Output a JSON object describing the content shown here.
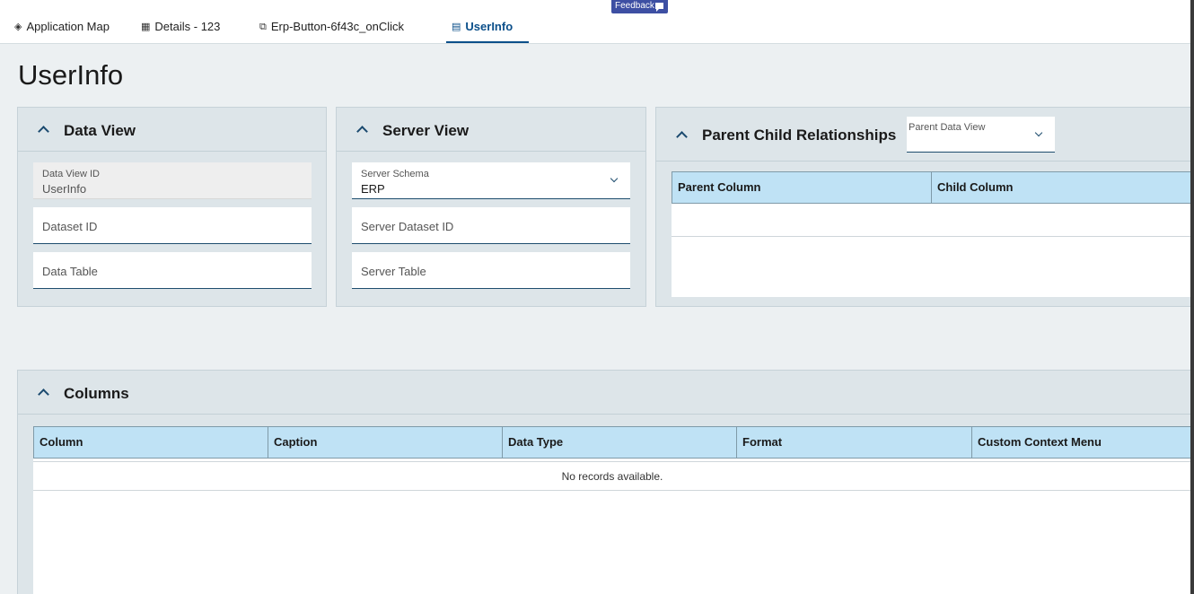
{
  "tabs": [
    {
      "label": "Application Map",
      "icon": "layers-icon"
    },
    {
      "label": "Details - 123",
      "icon": "grid-icon"
    },
    {
      "label": "Erp-Button-6f43c_onClick",
      "icon": "code-icon"
    },
    {
      "label": "UserInfo",
      "icon": "table-icon",
      "active": true
    }
  ],
  "feedback": {
    "label": "Feedback"
  },
  "page": {
    "title": "UserInfo"
  },
  "data_view": {
    "title": "Data View",
    "id_label": "Data View ID",
    "id_value": "UserInfo",
    "dataset_placeholder": "Dataset ID",
    "table_placeholder": "Data Table"
  },
  "server_view": {
    "title": "Server View",
    "schema_label": "Server Schema",
    "schema_value": "ERP",
    "dataset_placeholder": "Server Dataset ID",
    "table_placeholder": "Server Table"
  },
  "relationships": {
    "title": "Parent Child Relationships",
    "parent_dropdown_label": "Parent Data View",
    "columns": [
      "Parent Column",
      "Child Column"
    ]
  },
  "columns_panel": {
    "title": "Columns",
    "headers": [
      "Column",
      "Caption",
      "Data Type",
      "Format",
      "Custom Context Menu"
    ],
    "empty_text": "No records available."
  },
  "colors": {
    "accent": "#0b4f8a",
    "panel_bg": "#dde5e9",
    "grid_header": "#bfe2f5",
    "feedback_bg": "#3d4fa3"
  }
}
